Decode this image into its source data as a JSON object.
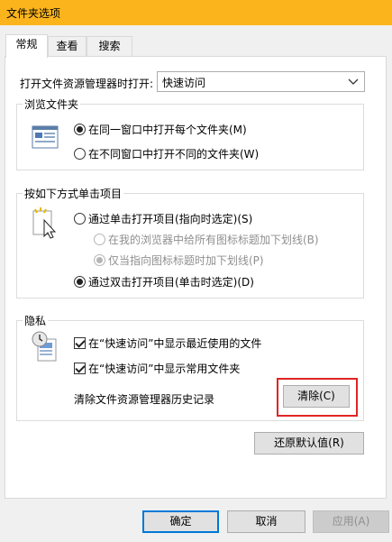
{
  "window": {
    "title": "文件夹选项"
  },
  "tabs": [
    {
      "label": "常规",
      "active": true
    },
    {
      "label": "查看",
      "active": false
    },
    {
      "label": "搜索",
      "active": false
    }
  ],
  "general": {
    "open_explorer_label": "打开文件资源管理器时打开:",
    "open_explorer_value": "快速访问",
    "browse_folders": {
      "legend": "浏览文件夹",
      "options": [
        {
          "label": "在同一窗口中打开每个文件夹(M)",
          "selected": true
        },
        {
          "label": "在不同窗口中打开不同的文件夹(W)",
          "selected": false
        }
      ]
    },
    "click_items": {
      "legend": "按如下方式单击项目",
      "single_click": "通过单击打开项目(指向时选定)(S)",
      "underline_all": "在我的浏览器中给所有图标标题加下划线(B)",
      "underline_hover": "仅当指向图标标题时加下划线(P)",
      "double_click": "通过双击打开项目(单击时选定)(D)"
    },
    "privacy": {
      "legend": "隐私",
      "show_recent_files": "在“快速访问”中显示最近使用的文件",
      "show_frequent_folders": "在“快速访问”中显示常用文件夹",
      "clear_history_label": "清除文件资源管理器历史记录",
      "clear_button": "清除(C)"
    },
    "restore_defaults_button": "还原默认值(R)"
  },
  "footer": {
    "ok": "确定",
    "cancel": "取消",
    "apply": "应用(A)"
  },
  "colors": {
    "title_bar": "#fbb41c",
    "highlight_box": "#e02424",
    "primary_border": "#0078d7"
  }
}
